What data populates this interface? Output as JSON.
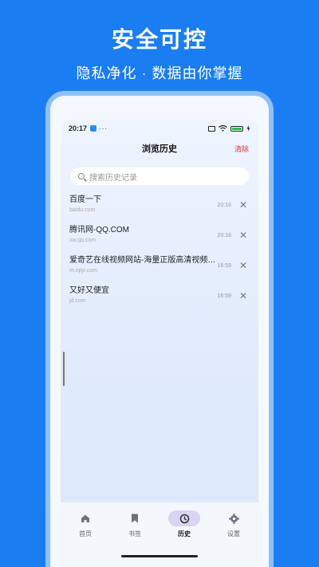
{
  "promo": {
    "title": "安全可控",
    "subtitle": "隐私净化 ·  数据由你掌握"
  },
  "statusbar": {
    "time": "20:17",
    "dots": "···"
  },
  "header": {
    "title": "浏览历史",
    "clear_label": "清除"
  },
  "search": {
    "placeholder": "搜索历史记录"
  },
  "history": [
    {
      "title": "百度一下",
      "url": "baidu.com",
      "time": "20:16"
    },
    {
      "title": "腾讯网-QQ.COM",
      "url": "xw.qq.com",
      "time": "20:16"
    },
    {
      "title": "爱奇艺在线视频网站-海量正版高清视频在线...",
      "url": "m.iqiyi.com",
      "time": "16:59"
    },
    {
      "title": "又好又便宜",
      "url": "jd.com",
      "time": "16:59"
    }
  ],
  "tabs": [
    {
      "label": "首页",
      "icon": "home-icon"
    },
    {
      "label": "书签",
      "icon": "bookmark-icon"
    },
    {
      "label": "历史",
      "icon": "history-icon",
      "active": true
    },
    {
      "label": "设置",
      "icon": "gear-icon"
    }
  ],
  "colors": {
    "background": "#1a7ef2",
    "clear": "#e23b3b",
    "active_tab": "#d9d4f2"
  }
}
